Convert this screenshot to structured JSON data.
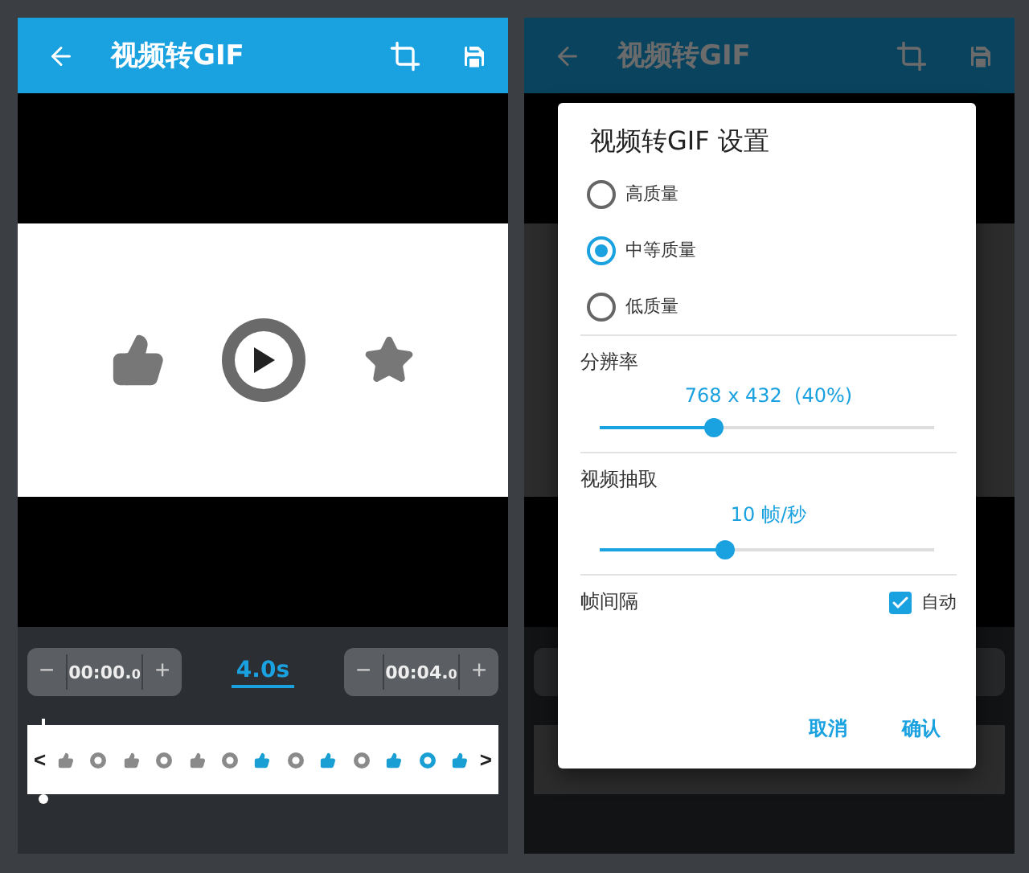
{
  "editor": {
    "title": "视频转GIF",
    "start_time": {
      "minus": "−",
      "value": "00:00.$_{0}$",
      "plus": "+"
    },
    "duration": "4.0s",
    "end_time": {
      "minus": "−",
      "value": "00:04.$_{0}$",
      "plus": "+"
    },
    "strip": {
      "prev": "<",
      "next": ">",
      "frames": [
        {
          "kind": "thumb",
          "color": "#8a8a8a"
        },
        {
          "kind": "disc",
          "color": "#8a8a8a"
        },
        {
          "kind": "thumb",
          "color": "#8a8a8a"
        },
        {
          "kind": "disc",
          "color": "#8a8a8a"
        },
        {
          "kind": "thumb",
          "color": "#8a8a8a"
        },
        {
          "kind": "disc",
          "color": "#8a8a8a"
        },
        {
          "kind": "thumb",
          "color": "#1a9fd4"
        },
        {
          "kind": "disc",
          "color": "#8a8a8a"
        },
        {
          "kind": "thumb",
          "color": "#1a9fd4"
        },
        {
          "kind": "disc",
          "color": "#8a8a8a"
        },
        {
          "kind": "thumb",
          "color": "#1a9fd4"
        },
        {
          "kind": "disc",
          "color": "#1a9fd4"
        },
        {
          "kind": "thumb",
          "color": "#1a9fd4"
        }
      ]
    }
  },
  "dialog_screen": {
    "title": "视频转GIF",
    "dialog": {
      "title": "视频转GIF 设置",
      "quality_options": [
        {
          "label": "高质量",
          "selected": false
        },
        {
          "label": "中等质量",
          "selected": true
        },
        {
          "label": "低质量",
          "selected": false
        }
      ],
      "resolution": {
        "label": "分辨率",
        "reading": "768 x 432  (40%)",
        "level": 0.34
      },
      "frame_rate": {
        "label": "视频抽取",
        "reading": "10 帧/秒",
        "level": 0.375
      },
      "frame_interval": {
        "label": "帧间隔",
        "auto_label": "自动",
        "checked": true
      },
      "buttons": [
        "取消",
        "确认"
      ]
    }
  }
}
